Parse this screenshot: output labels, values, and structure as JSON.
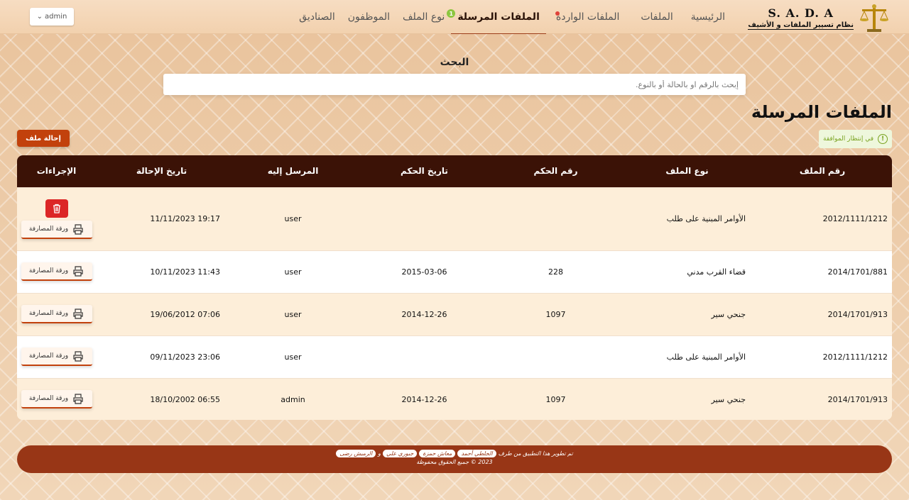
{
  "brand": {
    "title": "S. A. D. A",
    "subtitle": "نظام تسيير الملفات و الأشيف"
  },
  "nav": [
    {
      "label": "الرئيسية"
    },
    {
      "label": "الملفات"
    },
    {
      "label": "الملفات الواردة"
    },
    {
      "label": "الملفات المرسلة",
      "badge": "1"
    },
    {
      "label": "نوع الملف"
    },
    {
      "label": "الموظفون"
    },
    {
      "label": "الصناديق"
    }
  ],
  "user": {
    "name": "admin"
  },
  "search": {
    "label": "البحث",
    "placeholder": "إبحث بالرقم او بالحالة أو بالنوع."
  },
  "page": {
    "title": "الملفات المرسلة",
    "pending_label": "في إنتظار الموافقة",
    "refer_button": "إحالة ملف"
  },
  "table": {
    "headers": [
      "رقم الملف",
      "نوع الملف",
      "رقم الحكم",
      "تاريخ الحكم",
      "المرسل إليه",
      "تاريخ الإحالة",
      "الإجراءات"
    ],
    "print_label": "ورقة المصارفة",
    "rows": [
      {
        "file_no": "2012/1111/1212",
        "type": "الأوامر المبنية على طلب",
        "ruling_no": "",
        "ruling_date": "",
        "to": "user",
        "referral_date": "19:17 11/11/2023"
      },
      {
        "file_no": "2014/1701/881",
        "type": "قضاء القرب مدني",
        "ruling_no": "228",
        "ruling_date": "2015-03-06",
        "to": "user",
        "referral_date": "11:43 10/11/2023"
      },
      {
        "file_no": "2014/1701/913",
        "type": "جنحي سير",
        "ruling_no": "1097",
        "ruling_date": "2014-12-26",
        "to": "user",
        "referral_date": "07:06 19/06/2012"
      },
      {
        "file_no": "2012/1111/1212",
        "type": "الأوامر المبنية على طلب",
        "ruling_no": "",
        "ruling_date": "",
        "to": "user",
        "referral_date": "23:06 09/11/2023"
      },
      {
        "file_no": "2014/1701/913",
        "type": "جنحي سير",
        "ruling_no": "1097",
        "ruling_date": "2014-12-26",
        "to": "admin",
        "referral_date": "06:55 18/10/2002"
      }
    ]
  },
  "footer": {
    "prefix": "تم تطوير هذا التطبيق من طرف",
    "devs": [
      "الجلطي أحمد",
      "معاش حمزة",
      "جبوري علي"
    ],
    "and": "و",
    "last_dev": "الرميش رضى",
    "copyright": "2023 © جميع الحقوق محفوظة"
  }
}
